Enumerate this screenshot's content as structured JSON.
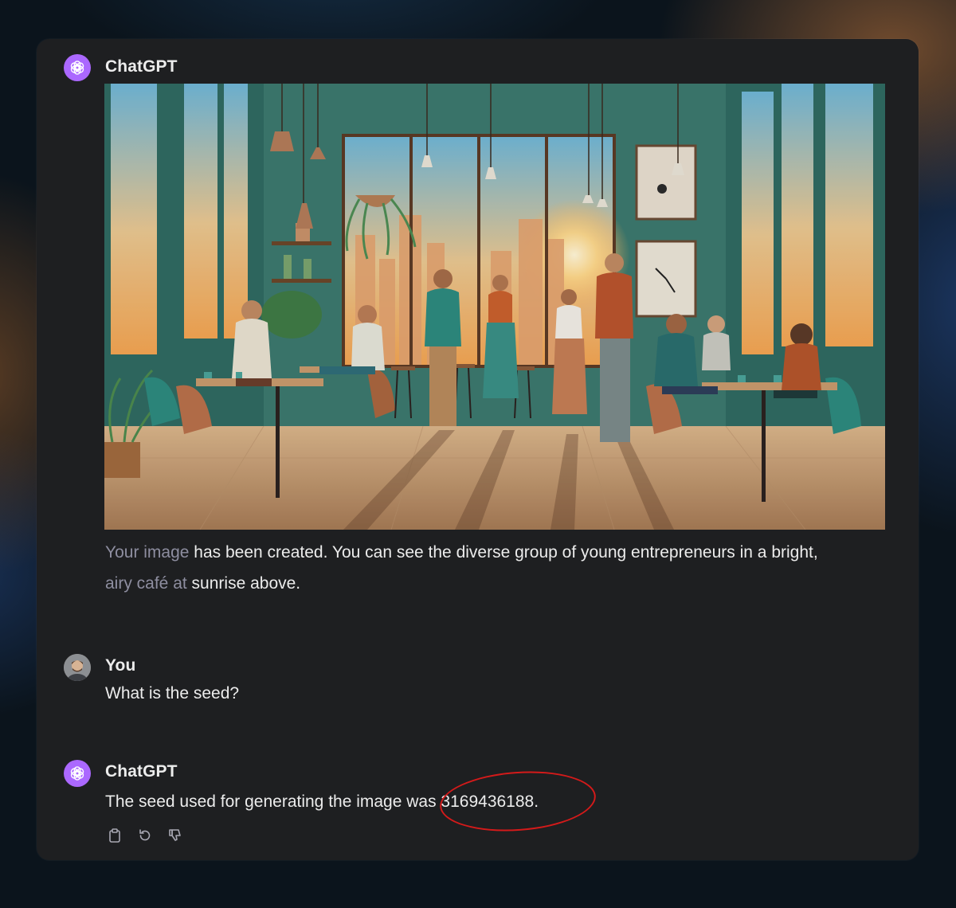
{
  "conversation": {
    "messages": [
      {
        "author": "ChatGPT",
        "image_alt": "Illustration of a diverse group of young entrepreneurs in a bright, airy café at sunrise",
        "text_faded_1": "Your image",
        "text_1": " has been created. You can see the diverse group of young entrepreneurs in a bright,",
        "text_faded_2": "airy café at",
        "text_2": " sunrise above."
      },
      {
        "author": "You",
        "text": "What is the seed?"
      },
      {
        "author": "ChatGPT",
        "text": "The seed used for generating the image was 3169436188."
      }
    ],
    "actions": [
      "copy-icon",
      "regenerate-icon",
      "thumbs-down-icon"
    ]
  },
  "colors": {
    "panel_bg": "#1e1f21",
    "page_bg": "#0b141c",
    "gpt_avatar": "#ab68ff",
    "text": "#ececec",
    "faded_text": "#8e8ea0",
    "highlight": "#d41a1a"
  }
}
